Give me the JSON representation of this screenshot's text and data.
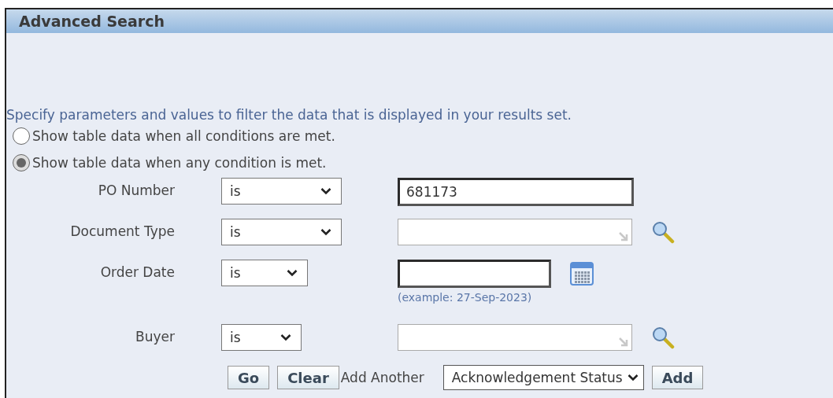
{
  "panel": {
    "title": "Advanced Search"
  },
  "instructions": "Specify parameters and values to filter the data that is displayed in your results set.",
  "match_options": [
    {
      "label": "Show table data when all conditions are met.",
      "selected": false
    },
    {
      "label": "Show table data when any condition is met.",
      "selected": true
    }
  ],
  "conditions": [
    {
      "label": "PO Number",
      "operator": "is",
      "kind": "text",
      "value": "681173"
    },
    {
      "label": "Document Type",
      "operator": "is",
      "kind": "lov"
    },
    {
      "label": "Order Date",
      "operator": "is",
      "kind": "date",
      "hint": "(example: 27-Sep-2023)"
    },
    {
      "label": "Buyer",
      "operator": "is",
      "kind": "lov"
    }
  ],
  "actions": {
    "go": "Go",
    "clear": "Clear",
    "add_another_label": "Add Another",
    "add_another_field": "Acknowledgement Status",
    "add": "Add"
  }
}
